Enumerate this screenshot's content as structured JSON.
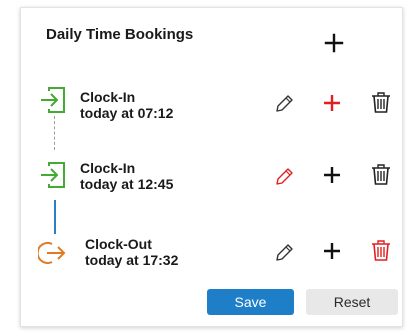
{
  "panel": {
    "title": "Daily Time Bookings"
  },
  "bookings": [
    {
      "type": "Clock-In",
      "time": "today at 07:12",
      "icon": "clock-in-icon",
      "icon_color": "#44aa33",
      "add_color": "#e02020",
      "edit_color": "#333333",
      "delete_color": "#222222"
    },
    {
      "type": "Clock-In",
      "time": "today at 12:45",
      "icon": "clock-in-icon",
      "icon_color": "#44aa33",
      "add_color": "#111111",
      "edit_color": "#e02020",
      "delete_color": "#222222"
    },
    {
      "type": "Clock-Out",
      "time": "today at 17:32",
      "icon": "clock-out-icon",
      "icon_color": "#e07b22",
      "add_color": "#111111",
      "edit_color": "#333333",
      "delete_color": "#e02020"
    }
  ],
  "actions": {
    "save_label": "Save",
    "reset_label": "Reset"
  },
  "colors": {
    "primary": "#1e7fc8",
    "danger": "#e02020",
    "clock_in": "#44aa33",
    "clock_out": "#e07b22"
  }
}
